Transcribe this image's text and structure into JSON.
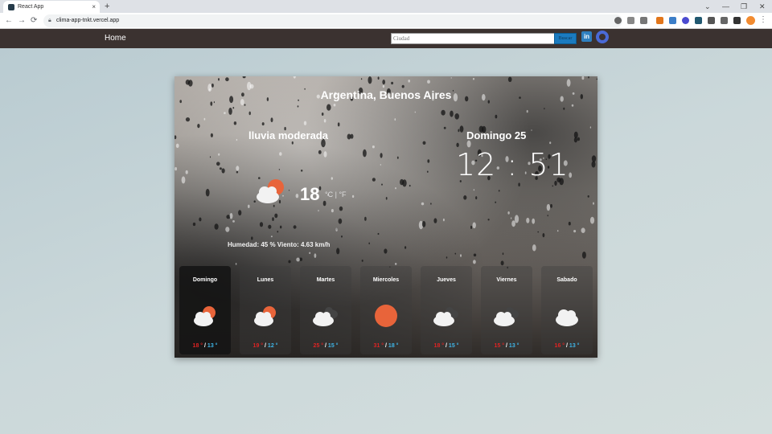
{
  "browser": {
    "tab_title": "React App",
    "tab_close": "×",
    "new_tab": "+",
    "url": "clima-app-tnkt.vercel.app",
    "window_controls": [
      "⌄",
      "—",
      "❐",
      "✕"
    ],
    "nav": {
      "back": "←",
      "forward": "→",
      "reload": "⟳"
    },
    "menu": "⋮"
  },
  "navbar": {
    "home": "Home",
    "search_placeholder": "Ciudad",
    "search_button": "Buscar",
    "linkedin": "in"
  },
  "weather": {
    "location": "Argentina, Buenos Aires",
    "condition": "lluvia moderada",
    "day": "Domingo 25",
    "time": "12 : 51",
    "temperature": "18",
    "unit": "°C | °F",
    "details": "Humedad: 45 %    Viento: 4.63 km/h"
  },
  "forecast": [
    {
      "day": "Domingo",
      "max": "18 °",
      "min": "13 °",
      "icon": "cloud-sun-icon",
      "active": true
    },
    {
      "day": "Lunes",
      "max": "19 °",
      "min": "12 °",
      "icon": "cloud-sun-icon",
      "active": false
    },
    {
      "day": "Martes",
      "max": "25 °",
      "min": "15 °",
      "icon": "clouds-icon",
      "active": false
    },
    {
      "day": "Miercoles",
      "max": "31 °",
      "min": "18 °",
      "icon": "sun-icon",
      "active": false
    },
    {
      "day": "Jueves",
      "max": "18 °",
      "min": "15 °",
      "icon": "clouds-icon",
      "active": false
    },
    {
      "day": "Viernes",
      "max": "15 °",
      "min": "13 °",
      "icon": "clouds-icon",
      "active": false
    },
    {
      "day": "Sabado",
      "max": "16 °",
      "min": "13 °",
      "icon": "cloud-icon",
      "active": false
    }
  ],
  "colors": {
    "navbar": "#3b3230",
    "max_temp": "#e02323",
    "min_temp": "#3fb6e8",
    "sun": "#e8643a"
  }
}
